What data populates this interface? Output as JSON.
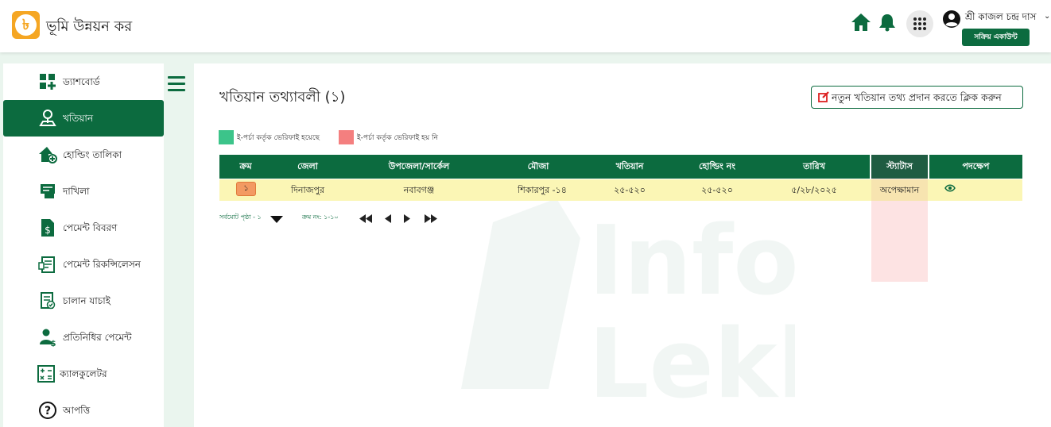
{
  "header": {
    "app_title": "ভূমি উন্নয়ন কর",
    "logo_glyph": "৳",
    "user_name": "শ্রী কাজল চন্দ্র দাস",
    "account_button": "সক্রিয় একাউন্ট",
    "icons": [
      "home-icon",
      "bell-icon",
      "apps-grid-icon",
      "user-icon"
    ]
  },
  "sidebar": {
    "items": [
      {
        "label": "ড্যাশবোর্ড",
        "icon": "dashboard-icon"
      },
      {
        "label": "খতিয়ান",
        "icon": "land-pin-icon",
        "active": true
      },
      {
        "label": "হোল্ডিং তালিকা",
        "icon": "house-add-icon"
      },
      {
        "label": "দাখিলা",
        "icon": "receipt-icon"
      },
      {
        "label": "পেমেন্ট বিবরণ",
        "icon": "payment-doc-icon"
      },
      {
        "label": "পেমেন্ট রিকন্সিলেসন",
        "icon": "reconcile-icon"
      },
      {
        "label": "চালান যাচাই",
        "icon": "challan-check-icon"
      },
      {
        "label": "প্রতিনিধির পেমেন্ট",
        "icon": "representative-payment-icon"
      },
      {
        "label": "ক্যালকুলেটর",
        "icon": "calculator-icon"
      },
      {
        "label": "আপত্তি",
        "icon": "question-icon"
      }
    ]
  },
  "main": {
    "title": "খতিয়ান তথ্যাবলী (১)",
    "new_button": "নতুন খতিয়ান তথ্য প্রদান করতে ক্লিক করুন",
    "legend": [
      {
        "label": "ই-পর্চা কর্তৃক ভেরিফাই হয়েছে",
        "color": "#3cc48a"
      },
      {
        "label": "ই-পর্চা কর্তৃক ভেরিফাই হয় নি",
        "color": "#f47f7f"
      }
    ],
    "table": {
      "columns": [
        "ক্রম",
        "জেলা",
        "উপজেলা/সার্কেল",
        "মৌজা",
        "খতিয়ান",
        "হোল্ডিং নং",
        "তারিখ",
        "স্ট্যাটাস",
        "পদক্ষেপ"
      ],
      "rows": [
        {
          "serial": "১",
          "district": "দিনাজপুর",
          "upazila": "নবাবগঞ্জ",
          "mouza": "শিকারপুর -১৪",
          "khatian": "২৫-৫২০",
          "holding": "২৫-৫২০",
          "date": "৫/২৮/২০২৫",
          "status": "অপেক্ষামান"
        }
      ]
    },
    "pager": {
      "page_label": "সর্বমোট পৃষ্ঠা - ১",
      "range_label": "ক্রম নং: ১-১০"
    }
  },
  "colors": {
    "brand": "#0c6b3f",
    "accent": "#f5a623",
    "row_highlight": "#fbf6b5"
  }
}
